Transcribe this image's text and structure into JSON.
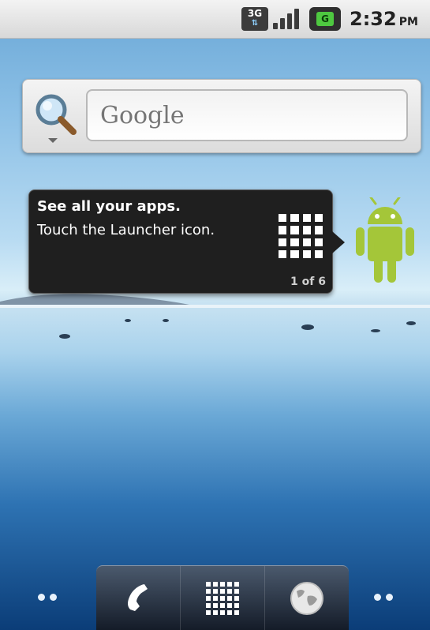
{
  "status_bar": {
    "network_label": "3G",
    "signal_icon": "signal-icon",
    "battery_label": "G",
    "time": "2:32",
    "ampm": "PM"
  },
  "search_widget": {
    "placeholder": "Google",
    "icon": "search-icon"
  },
  "tooltip": {
    "title": "See all your apps.",
    "body": "Touch the Launcher icon.",
    "counter": "1 of 6",
    "icon": "launcher-grid-icon"
  },
  "dock": {
    "items": [
      {
        "name": "phone",
        "icon": "phone-icon"
      },
      {
        "name": "launcher",
        "icon": "app-grid-icon"
      },
      {
        "name": "browser",
        "icon": "globe-icon"
      }
    ]
  },
  "colors": {
    "tooltip_bg": "#1f1f1f",
    "android_green": "#a4c639",
    "battery_green": "#4ec840"
  }
}
